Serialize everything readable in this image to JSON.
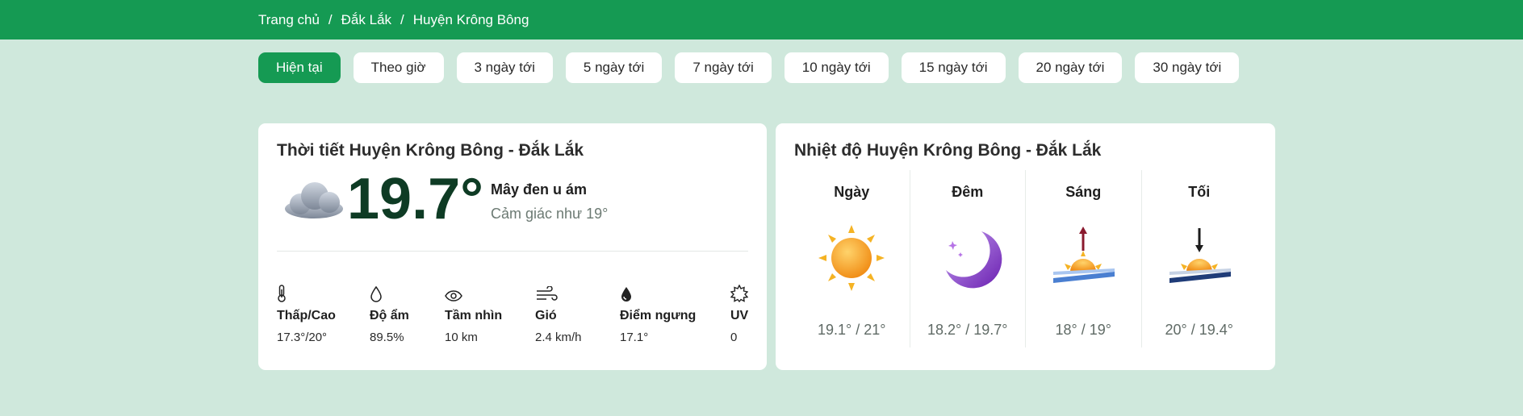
{
  "breadcrumb": {
    "home": "Trang chủ",
    "province": "Đắk Lắk",
    "district": "Huyện Krông Bông"
  },
  "tabs": [
    "Hiện tại",
    "Theo giờ",
    "3 ngày tới",
    "5 ngày tới",
    "7 ngày tới",
    "10 ngày tới",
    "15 ngày tới",
    "20 ngày tới",
    "30 ngày tới"
  ],
  "current": {
    "title": "Thời tiết Huyện Krông Bông - Đắk Lắk",
    "icon": "cloud-icon",
    "temperature": "19.7°",
    "description": "Mây đen u ám",
    "feels_like": "Cảm giác như 19°",
    "stats": [
      {
        "icon": "thermometer-icon",
        "label": "Thấp/Cao",
        "value": "17.3°/20°"
      },
      {
        "icon": "droplet-icon",
        "label": "Độ ẩm",
        "value": "89.5%"
      },
      {
        "icon": "eye-icon",
        "label": "Tầm nhìn",
        "value": "10 km"
      },
      {
        "icon": "wind-icon",
        "label": "Gió",
        "value": "2.4 km/h"
      },
      {
        "icon": "dewpoint-icon",
        "label": "Điểm ngưng",
        "value": "17.1°"
      },
      {
        "icon": "sun-uv-icon",
        "label": "UV",
        "value": "0"
      }
    ]
  },
  "temperature": {
    "title": "Nhiệt độ Huyện Krông Bông - Đắk Lắk",
    "periods": [
      {
        "name": "Ngày",
        "icon": "sun-icon",
        "range": "19.1° / 21°"
      },
      {
        "name": "Đêm",
        "icon": "moon-icon",
        "range": "18.2° / 19.7°"
      },
      {
        "name": "Sáng",
        "icon": "sunrise-icon",
        "range": "18° / 19°"
      },
      {
        "name": "Tối",
        "icon": "sunset-icon",
        "range": "20° / 19.4°"
      }
    ]
  }
}
